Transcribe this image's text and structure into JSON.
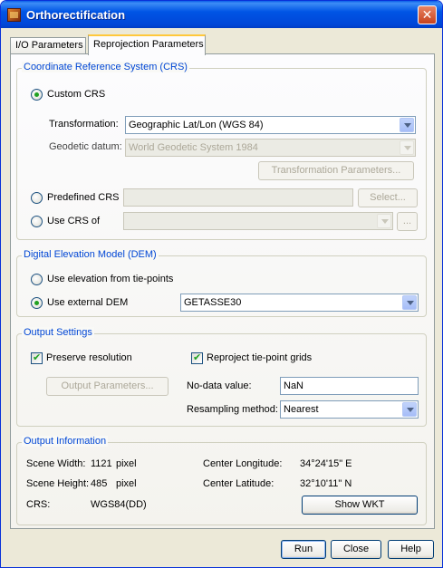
{
  "window": {
    "title": "Orthorectification",
    "close_glyph": "✕"
  },
  "tabs": [
    {
      "label": "I/O Parameters",
      "active": false
    },
    {
      "label": "Reprojection Parameters",
      "active": true
    }
  ],
  "crs": {
    "title": "Coordinate Reference System (CRS)",
    "custom_label": "Custom CRS",
    "custom_selected": true,
    "transformation_label": "Transformation:",
    "transformation_value": "Geographic Lat/Lon (WGS 84)",
    "datum_label": "Geodetic datum:",
    "datum_value": "World Geodetic System 1984",
    "transform_params_button": "Transformation Parameters...",
    "predefined_label": "Predefined CRS",
    "predefined_value": "",
    "select_button": "Select...",
    "use_crs_of_label": "Use CRS of",
    "use_crs_of_value": "",
    "ellipsis_button": "..."
  },
  "dem": {
    "title": "Digital Elevation Model (DEM)",
    "tiepoints_label": "Use elevation from tie-points",
    "external_label": "Use external DEM",
    "external_selected": true,
    "dem_value": "GETASSE30"
  },
  "output": {
    "title": "Output Settings",
    "preserve_label": "Preserve resolution",
    "preserve_checked": true,
    "reproject_label": "Reproject tie-point grids",
    "reproject_checked": true,
    "output_params_button": "Output Parameters...",
    "nodata_label": "No-data value:",
    "nodata_value": "NaN",
    "resampling_label": "Resampling method:",
    "resampling_value": "Nearest"
  },
  "info": {
    "title": "Output Information",
    "scene_width_label": "Scene Width:",
    "scene_width_value": "1121",
    "scene_width_unit": "pixel",
    "scene_height_label": "Scene Height:",
    "scene_height_value": "485",
    "scene_height_unit": "pixel",
    "crs_label": "CRS:",
    "crs_value": "WGS84(DD)",
    "center_lon_label": "Center Longitude:",
    "center_lon_value": "34°24'15\" E",
    "center_lat_label": "Center Latitude:",
    "center_lat_value": "32°10'11\" N",
    "show_wkt_button": "Show WKT"
  },
  "footer": {
    "run_button": "Run",
    "close_button": "Close",
    "help_button": "Help"
  }
}
